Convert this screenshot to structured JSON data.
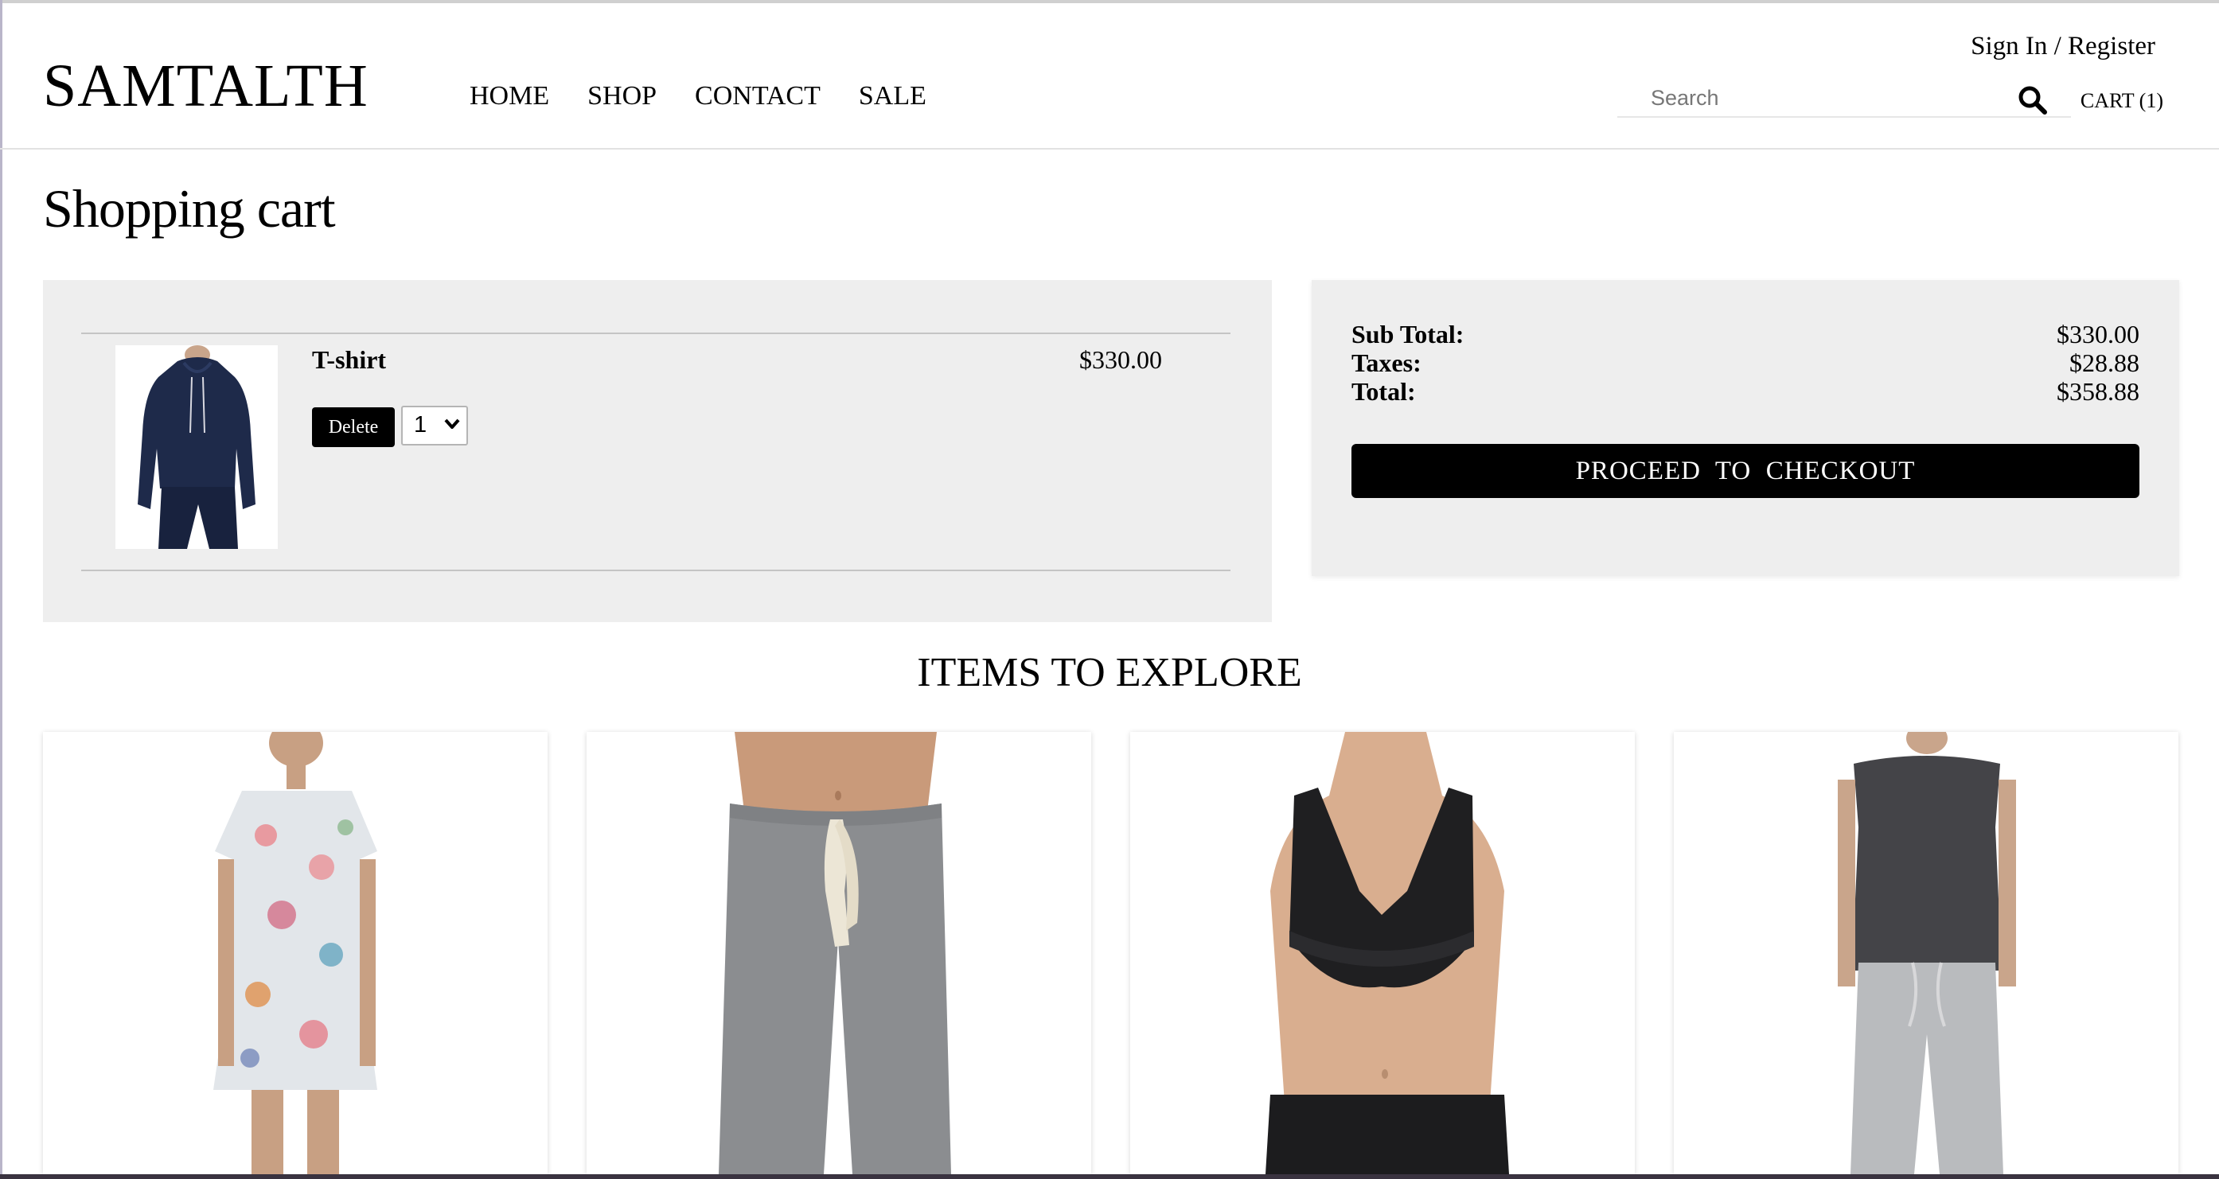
{
  "header": {
    "logo": "SAMTALTH",
    "nav": [
      "HOME",
      "SHOP",
      "CONTACT",
      "SALE"
    ],
    "signin": "Sign In / Register",
    "search_placeholder": "Search",
    "cart_label": "CART (1)"
  },
  "page_title": "Shopping cart",
  "cart": {
    "items": [
      {
        "name": "T-shirt",
        "price": "$330.00",
        "delete_label": "Delete",
        "quantity": "1"
      }
    ]
  },
  "summary": {
    "subtotal_label": "Sub Total:",
    "subtotal_value": "$330.00",
    "taxes_label": "Taxes:",
    "taxes_value": "$28.88",
    "total_label": "Total:",
    "total_value": "$358.88",
    "checkout_label": "PROCEED  TO  CHECKOUT"
  },
  "explore": {
    "title": "ITEMS TO EXPLORE",
    "items": [
      {
        "image": "floral-dress-image"
      },
      {
        "image": "grey-sweatpants-image"
      },
      {
        "image": "black-bralette-image"
      },
      {
        "image": "grey-tank-joggers-image"
      }
    ]
  },
  "colors": {
    "panel_bg": "#eeeeee",
    "button_bg": "#000000",
    "button_text": "#ffffff"
  }
}
